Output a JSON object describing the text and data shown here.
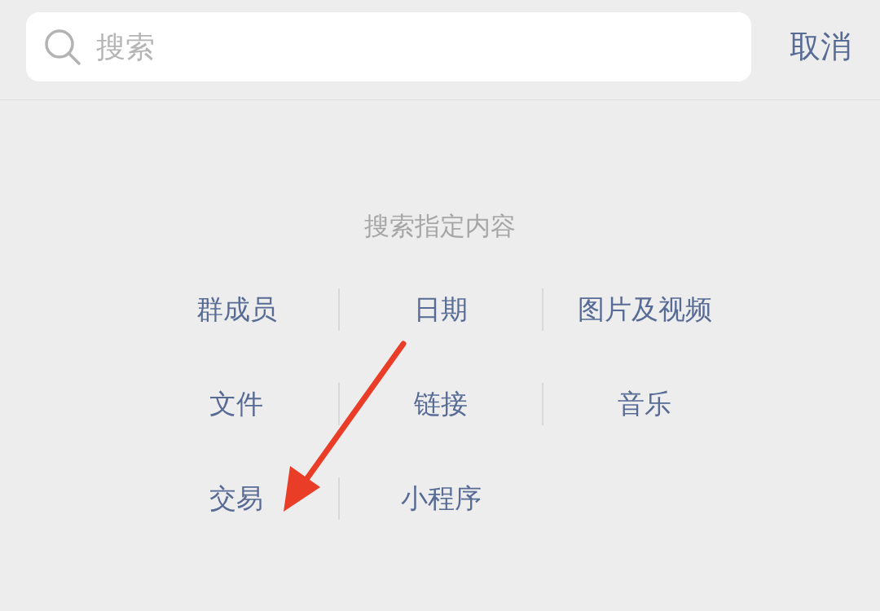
{
  "search": {
    "placeholder": "搜索"
  },
  "cancel": "取消",
  "section_title": "搜索指定内容",
  "categories": [
    "群成员",
    "日期",
    "图片及视频",
    "文件",
    "链接",
    "音乐",
    "交易",
    "小程序"
  ]
}
